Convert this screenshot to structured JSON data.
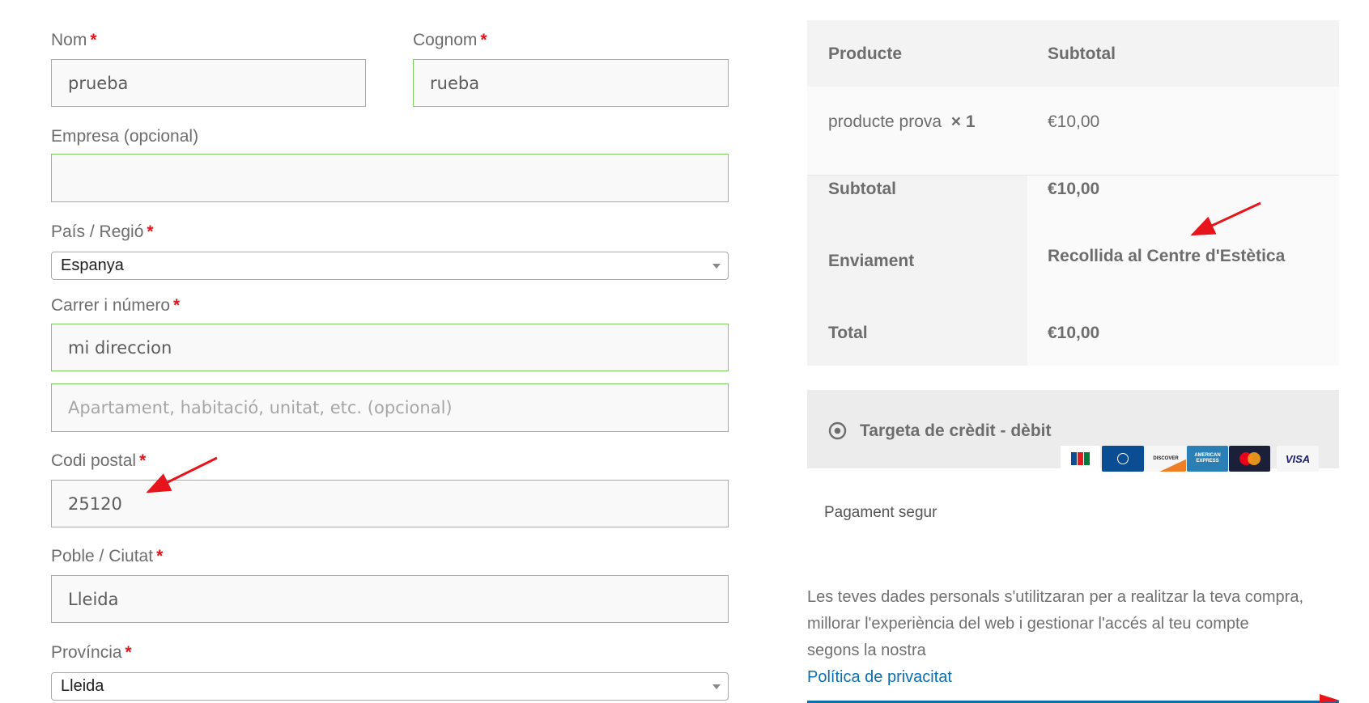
{
  "billing": {
    "first_name": {
      "label": "Nom",
      "value": "prueba"
    },
    "last_name": {
      "label": "Cognom",
      "value": "rueba"
    },
    "company": {
      "label": "Empresa (opcional)",
      "value": ""
    },
    "country": {
      "label": "País / Regió",
      "value": "Espanya"
    },
    "street": {
      "label": "Carrer i número",
      "value": "mi direccion",
      "placeholder2": "Apartament, habitació, unitat, etc. (opcional)"
    },
    "postcode": {
      "label": "Codi postal",
      "value": "25120"
    },
    "city": {
      "label": "Poble / Ciutat",
      "value": "Lleida"
    },
    "province": {
      "label": "Província",
      "value": "Lleida"
    },
    "required_mark": "*"
  },
  "order": {
    "header": {
      "product": "Producte",
      "subtotal": "Subtotal"
    },
    "item": {
      "name": "producte prova",
      "qty": "× 1",
      "price": "€10,00"
    },
    "subtotal": {
      "label": "Subtotal",
      "value": "€10,00"
    },
    "shipping": {
      "label": "Enviament",
      "value": "Recollida al Centre d'Estètica"
    },
    "total": {
      "label": "Total",
      "value": "€10,00"
    }
  },
  "payment": {
    "method": "Targeta de crèdit - dèbit",
    "cards": {
      "jcb": "JCB",
      "diners": "Diners Club",
      "discover": "DISCOVER",
      "amex": "AMERICAN EXPRESS",
      "mastercard": "mastercard",
      "visa": "VISA"
    },
    "secure": "Pagament segur"
  },
  "privacy": {
    "text_line1": "Les teves dades personals s'utilitzaran per a realitzar la teva compra,",
    "text_line2": "millorar l'experiència del web i gestionar l'accés al teu compte",
    "text_line3": "segons la nostra",
    "link": "Política de privacitat"
  },
  "colors": {
    "valid_border": "#7ccc5a",
    "required": "#e2151b",
    "link": "#0a6fb0",
    "annotation": "#e8141b"
  }
}
